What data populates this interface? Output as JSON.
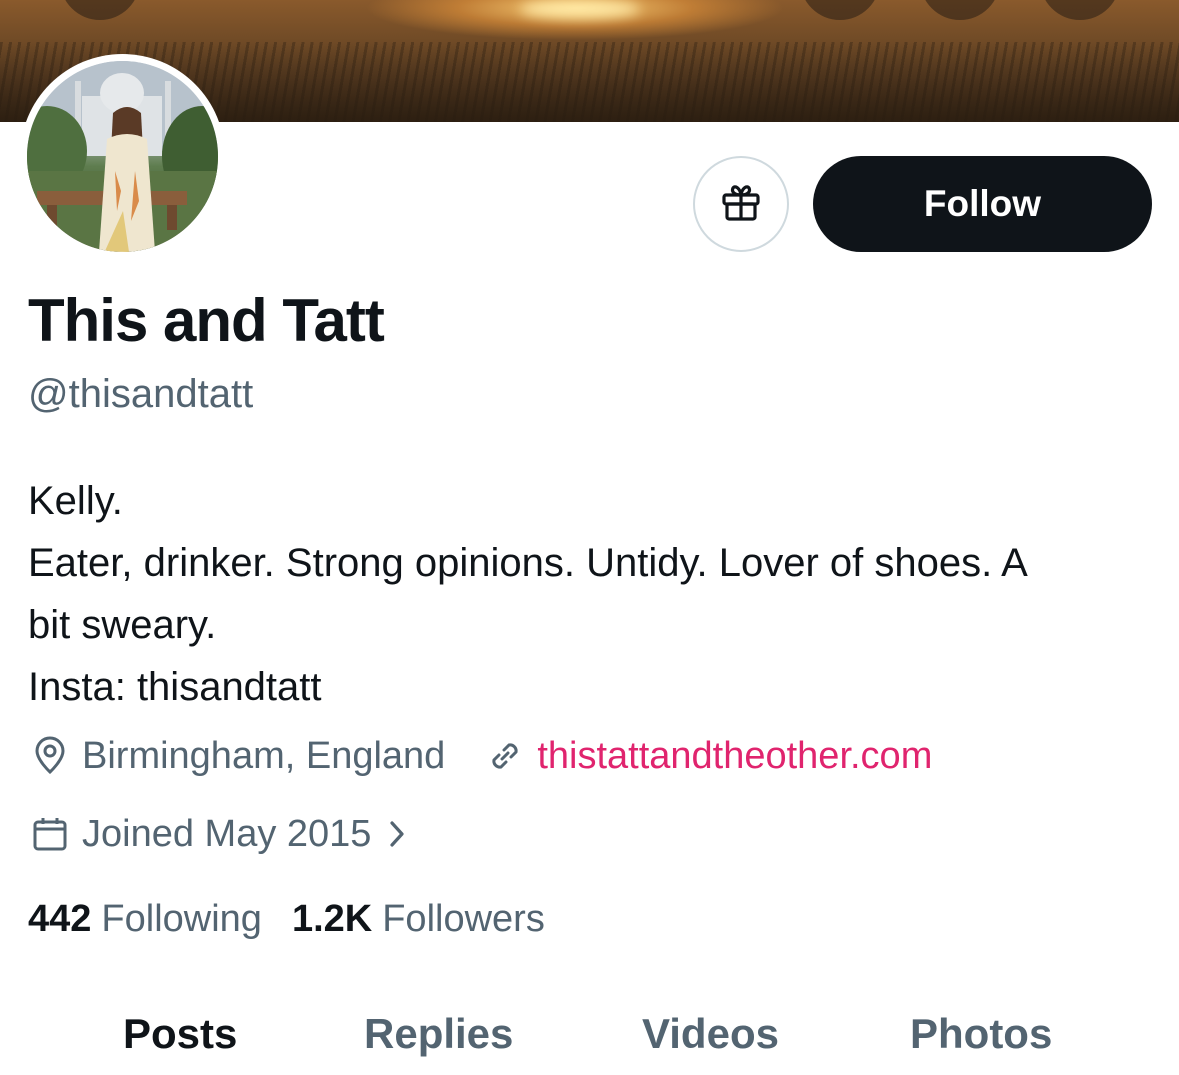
{
  "profile": {
    "display_name": "This and Tatt",
    "handle": "@thisandtatt",
    "bio_lines": [
      "Kelly.",
      "Eater, drinker. Strong opinions. Untidy. Lover of shoes. A",
      "bit sweary.",
      "Insta: thisandtatt"
    ],
    "location": "Birmingham, England",
    "website": "thistattandtheother.com",
    "joined": "Joined May 2015"
  },
  "actions": {
    "follow_label": "Follow",
    "gift_icon": "gift-icon"
  },
  "stats": {
    "following_count": "442",
    "following_label": "Following",
    "followers_count": "1.2K",
    "followers_label": "Followers"
  },
  "tabs": [
    {
      "label": "Posts",
      "active": true
    },
    {
      "label": "Replies",
      "active": false
    },
    {
      "label": "Videos",
      "active": false
    },
    {
      "label": "Photos",
      "active": false
    }
  ],
  "colors": {
    "text_primary": "#0f1419",
    "text_secondary": "#536471",
    "link": "#e0246e",
    "follow_button_bg": "#0f1419"
  }
}
